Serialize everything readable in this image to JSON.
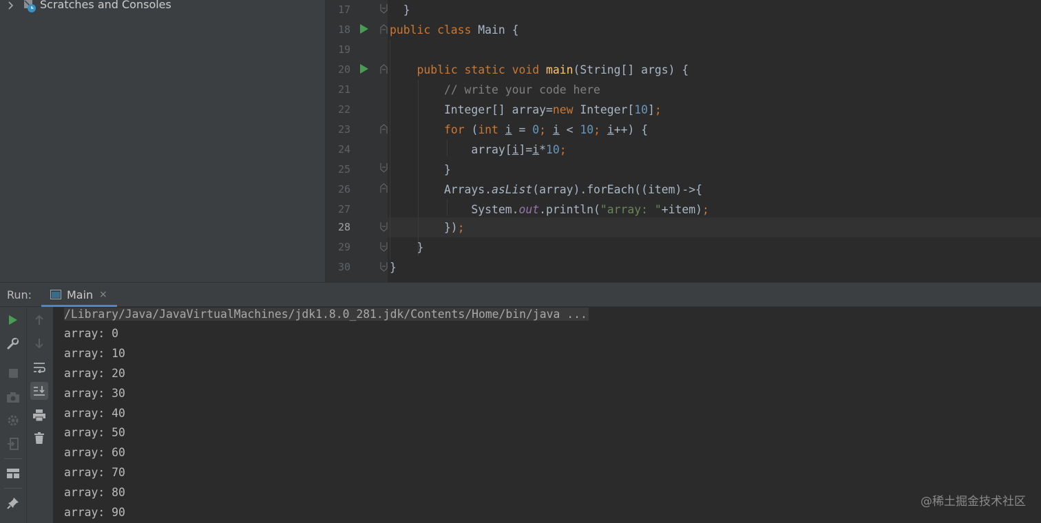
{
  "project": {
    "tree_item_label": "Scratches and Consoles"
  },
  "editor": {
    "line_numbers": [
      "17",
      "18",
      "19",
      "20",
      "21",
      "22",
      "23",
      "24",
      "25",
      "26",
      "27",
      "28",
      "29",
      "30"
    ],
    "current_line": "28"
  },
  "run": {
    "label": "Run:",
    "tab_label": "Main",
    "tab_close": "×",
    "command_line": "/Library/Java/JavaVirtualMachines/jdk1.8.0_281.jdk/Contents/Home/bin/java ...",
    "output": [
      "array: 0",
      "array: 10",
      "array: 20",
      "array: 30",
      "array: 40",
      "array: 50",
      "array: 60",
      "array: 70",
      "array: 80",
      "array: 90"
    ]
  },
  "watermark": "@稀土掘金技术社区",
  "colors": {
    "run_green": "#499c54",
    "accent_blue": "#4a88c7"
  },
  "icons": [
    "chevron-right-icon",
    "scratches-icon",
    "run-gutter-icon",
    "fold-icon",
    "run-icon",
    "wrench-icon",
    "stop-icon",
    "camera-icon",
    "settings-icon",
    "exit-icon",
    "layout-icon",
    "pin-icon",
    "up-arrow-icon",
    "down-arrow-icon",
    "soft-wrap-icon",
    "scroll-to-end-icon",
    "print-icon",
    "trash-icon"
  ]
}
